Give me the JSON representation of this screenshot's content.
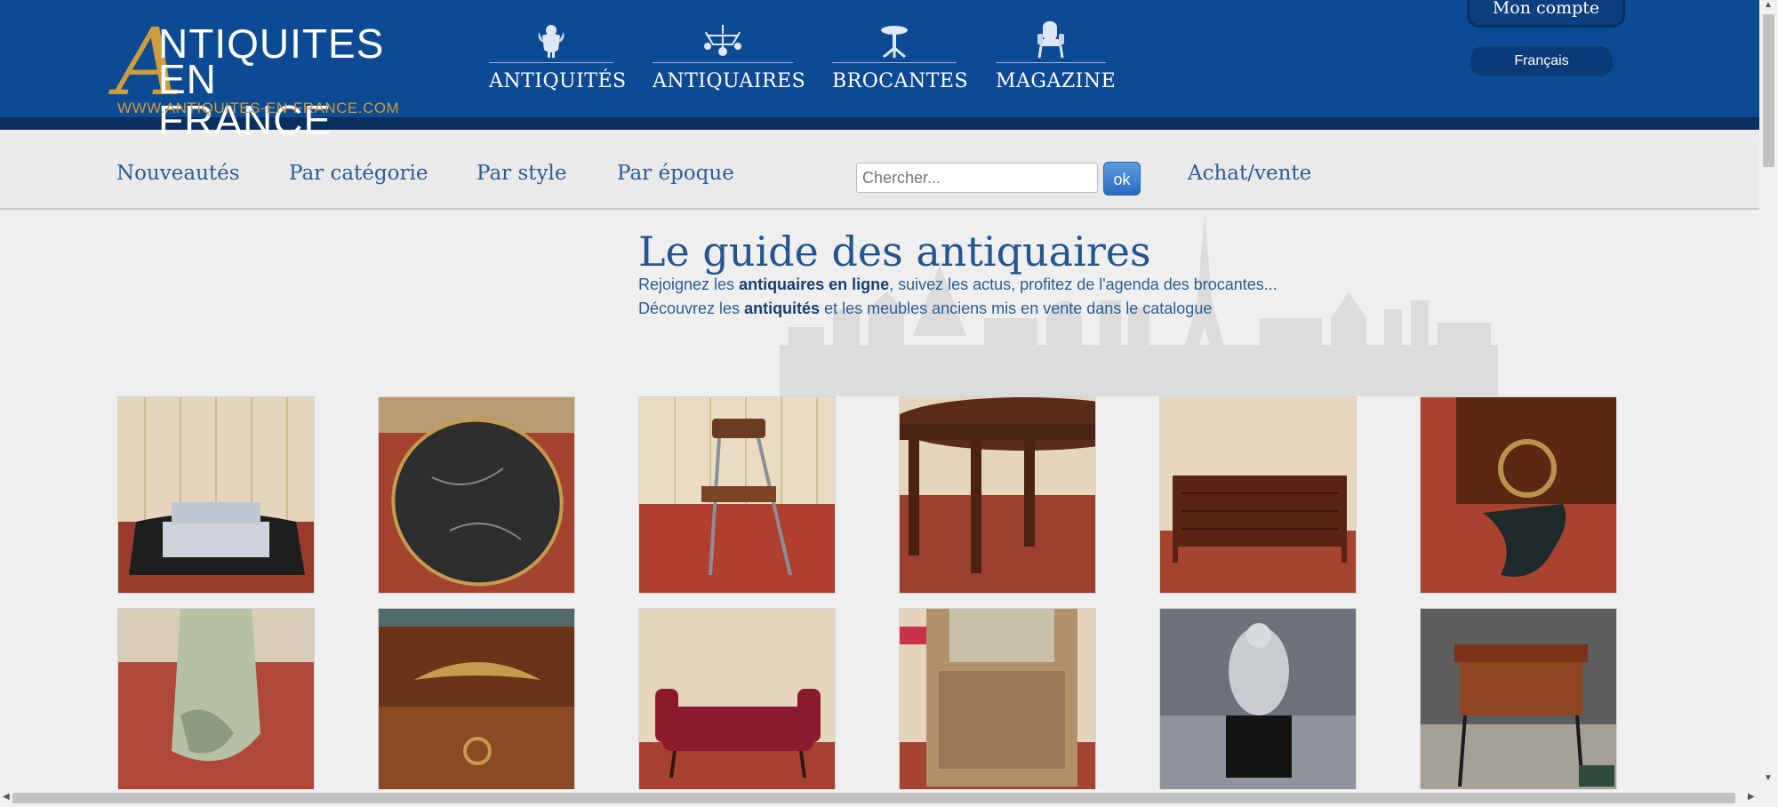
{
  "brand": {
    "logo_initial": "A",
    "logo_line1": "NTIQUITES",
    "logo_line2": "EN FRANCE",
    "logo_url": "WWW.ANTIQUITES-EN-FRANCE.COM",
    "gold": "#cc9d3c",
    "blue": "#0d4a94"
  },
  "main_nav": [
    {
      "label": "ANTIQUITÉS",
      "icon": "cherub-icon"
    },
    {
      "label": "ANTIQUAIRES",
      "icon": "chandelier-icon"
    },
    {
      "label": "BROCANTES",
      "icon": "gueridon-table-icon"
    },
    {
      "label": "MAGAZINE",
      "icon": "armchair-icon"
    }
  ],
  "account": {
    "label": "Mon compte"
  },
  "language": {
    "label": "Français"
  },
  "sub_nav": {
    "items": [
      "Nouveautés",
      "Par catégorie",
      "Par style",
      "Par époque"
    ],
    "search_placeholder": "Chercher...",
    "ok_label": "ok",
    "buy_sell": "Achat/vente"
  },
  "guide": {
    "title": "Le guide des antiquaires",
    "line1_a": "Rejoignez les ",
    "line1_b": "antiquaires en ligne",
    "line1_c": ", suivez les actus, profitez de l'agenda des brocantes...",
    "line2_a": "Découvrez les ",
    "line2_b": "antiquités",
    "line2_c": " et les meubles anciens mis en vente dans le catalogue"
  },
  "thumbnails": [
    {
      "subject": "black leather pet bed"
    },
    {
      "subject": "oval black marble tabletop"
    },
    {
      "subject": "folding chair with brown seat"
    },
    {
      "subject": "round mahogany table"
    },
    {
      "subject": "mahogany chest of drawers"
    },
    {
      "subject": "gilt bronze ornament on furniture"
    },
    {
      "subject": "carved painted furniture foot"
    },
    {
      "subject": "gilt bronze mount on commode"
    },
    {
      "subject": "red velvet banquette"
    },
    {
      "subject": "wooden vitrine cabinet"
    },
    {
      "subject": "silver statue on black base"
    },
    {
      "subject": "marquetry side table"
    }
  ]
}
